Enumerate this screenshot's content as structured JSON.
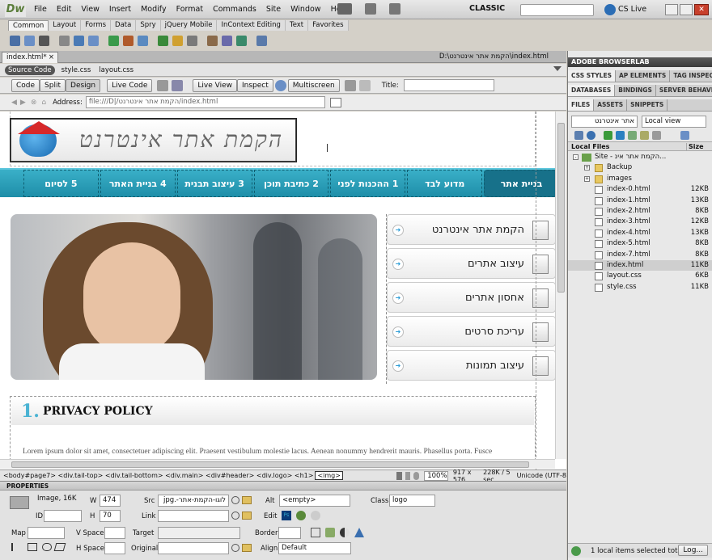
{
  "app": {
    "logo": "Dw",
    "workspace": "CLASSIC",
    "cslive": "CS Live"
  },
  "menu": [
    "File",
    "Edit",
    "View",
    "Insert",
    "Modify",
    "Format",
    "Commands",
    "Site",
    "Window",
    "Help"
  ],
  "insert_tabs": [
    "Common",
    "Layout",
    "Forms",
    "Data",
    "Spry",
    "jQuery Mobile",
    "InContext Editing",
    "Text",
    "Favorites"
  ],
  "doc": {
    "tab": "index.html*",
    "path": "D:\\הקמת אתר אינטרנט\\index.html",
    "related": [
      "Source Code",
      "style.css",
      "layout.css"
    ]
  },
  "doc_toolbar": {
    "code": "Code",
    "split": "Split",
    "design": "Design",
    "live_code": "Live Code",
    "live_view": "Live View",
    "inspect": "Inspect",
    "multiscreen": "Multiscreen",
    "title_label": "Title:",
    "title_value": ""
  },
  "address": {
    "label": "Address:",
    "value": "file:///D|/הקמת אתר אינטרנט/index.html"
  },
  "site": {
    "logo_text": "הקמת אתר אינטרנט",
    "nav": [
      "בניית אתר",
      "מדוע לבד",
      "1 ההכנות לפני",
      "2 כתיבת תוכן",
      "3 עיצוב תבנית",
      "4 בניית האתר",
      "5 לסיום"
    ],
    "side": [
      "הקמת אתר אינטרנט",
      "עיצוב אתרים",
      "אחסון אתרים",
      "עריכת סרטים",
      "עיצוב תמונות"
    ],
    "section_num": "1.",
    "section_title": "PRIVACY POLICY",
    "lorem": "Lorem ipsum dolor sit amet, consectetuer adipiscing elit. Praesent vestibulum molestie lacus. Aenean nonummy hendrerit mauris. Phasellus porta. Fusce"
  },
  "status": {
    "tags": "<body#page7> <div.tail-top> <div.tail-bottom> <div.main> <div#header> <div.logo> <h1>",
    "sel": "<img>",
    "zoom": "100%",
    "size": "917 x 576",
    "weight": "228K / 5 sec",
    "enc": "Unicode (UTF-8"
  },
  "props": {
    "title": "PROPERTIES",
    "image": "Image, 16K",
    "w_label": "W",
    "w": "474",
    "h_label": "H",
    "h": "70",
    "id_label": "ID",
    "src_label": "Src",
    "src": "לוגו-הקמת-אתר-.jpg",
    "link_label": "Link",
    "alt_label": "Alt",
    "alt": "<empty>",
    "edit_label": "Edit",
    "class_label": "Class",
    "class": "logo",
    "map_label": "Map",
    "vspace_label": "V Space",
    "hspace_label": "H Space",
    "target_label": "Target",
    "original_label": "Original",
    "border_label": "Border",
    "align_label": "Align",
    "align": "Default"
  },
  "panels": {
    "browserlab": "ADOBE BROWSERLAB",
    "tabs1": [
      "CSS STYLES",
      "AP ELEMENTS",
      "TAG INSPECTOR"
    ],
    "tabs2": [
      "DATABASES",
      "BINDINGS",
      "SERVER BEHAVIORS"
    ],
    "tabs3": [
      "FILES",
      "ASSETS",
      "SNIPPETS"
    ],
    "site_sel": "אתר אינטרנט",
    "view_sel": "Local view",
    "col1": "Local Files",
    "col2": "Size",
    "root": "Site - הקמת אתר אינ...",
    "footer": "1 local items selected tota",
    "log": "Log..."
  },
  "files": [
    {
      "name": "Backup",
      "size": "",
      "folder": true
    },
    {
      "name": "images",
      "size": "",
      "folder": true
    },
    {
      "name": "index-0.html",
      "size": "12KB"
    },
    {
      "name": "index-1.html",
      "size": "13KB"
    },
    {
      "name": "index-2.html",
      "size": "8KB"
    },
    {
      "name": "index-3.html",
      "size": "12KB"
    },
    {
      "name": "index-4.html",
      "size": "13KB"
    },
    {
      "name": "index-5.html",
      "size": "8KB"
    },
    {
      "name": "index-7.html",
      "size": "8KB"
    },
    {
      "name": "index.html",
      "size": "11KB",
      "sel": true
    },
    {
      "name": "layout.css",
      "size": "6KB"
    },
    {
      "name": "style.css",
      "size": "11KB"
    }
  ]
}
